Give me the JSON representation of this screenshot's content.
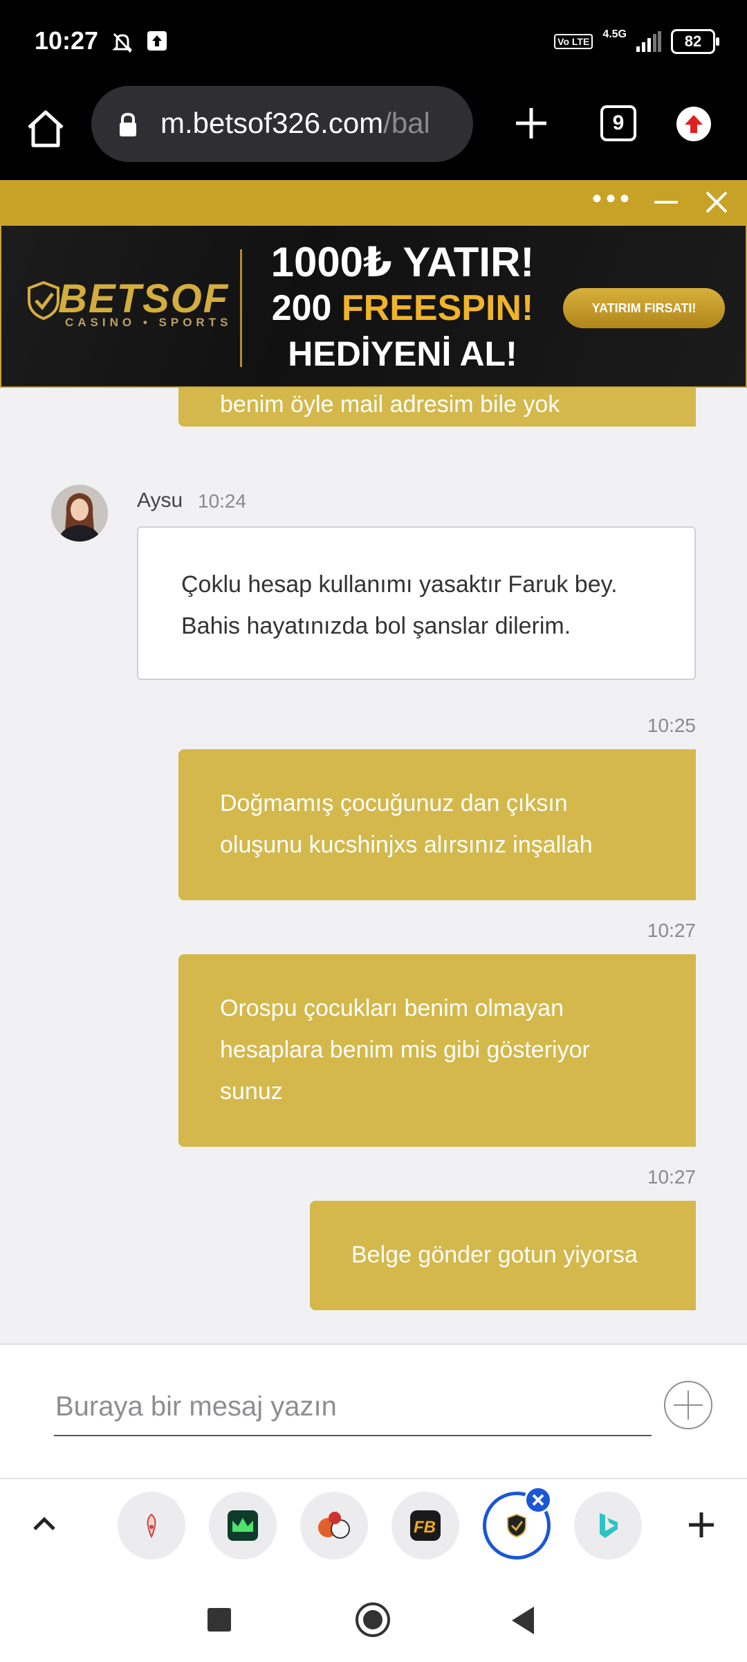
{
  "status_bar": {
    "time": "10:27",
    "network_badge": "Vo LTE",
    "network_type": "4.5G",
    "battery": "82"
  },
  "browser": {
    "url_main": "m.betsof326.com",
    "url_rest": "/bal",
    "tab_count": "9"
  },
  "banner": {
    "logo": "BETSOF",
    "logo_sub": "CASINO • SPORTS",
    "line1": "1000₺ YATIR!",
    "line2_a": "200 ",
    "line2_b": "FREESPIN!",
    "line3": "HEDİYENİ AL!",
    "cta": "YATIRIM FIRSATI!"
  },
  "chat": {
    "msg_partial": "benim öyle mail adresim bile yok",
    "agent": {
      "name": "Aysu",
      "time": "10:24",
      "message": "Çoklu hesap kullanımı yasaktır Faruk bey. Bahis hayatınızda bol şanslar dilerim."
    },
    "msg1": {
      "time": "10:25",
      "text": "Doğmamış çocuğunuz dan çıksın oluşunu kucshinjxs alırsınız inşallah"
    },
    "msg2": {
      "time": "10:27",
      "text": "Orospu çocukları benim olmayan hesaplara benim mis gibi gösteriyor sunuz"
    },
    "msg3": {
      "time": "10:27",
      "text": "Belge gönder gotun yiyorsa"
    }
  },
  "input": {
    "placeholder": "Buraya bir mesaj yazın"
  },
  "colors": {
    "header_gold": "#c8a227",
    "bubble_gold": "#d4b84b",
    "active_tab_blue": "#1a56d6"
  },
  "tabs": [
    "weather-tab-icon",
    "casino-crown-tab-icon",
    "sports-ball-tab-icon",
    "fb-tab-icon",
    "betsof-shield-tab-icon",
    "bing-tab-icon"
  ]
}
